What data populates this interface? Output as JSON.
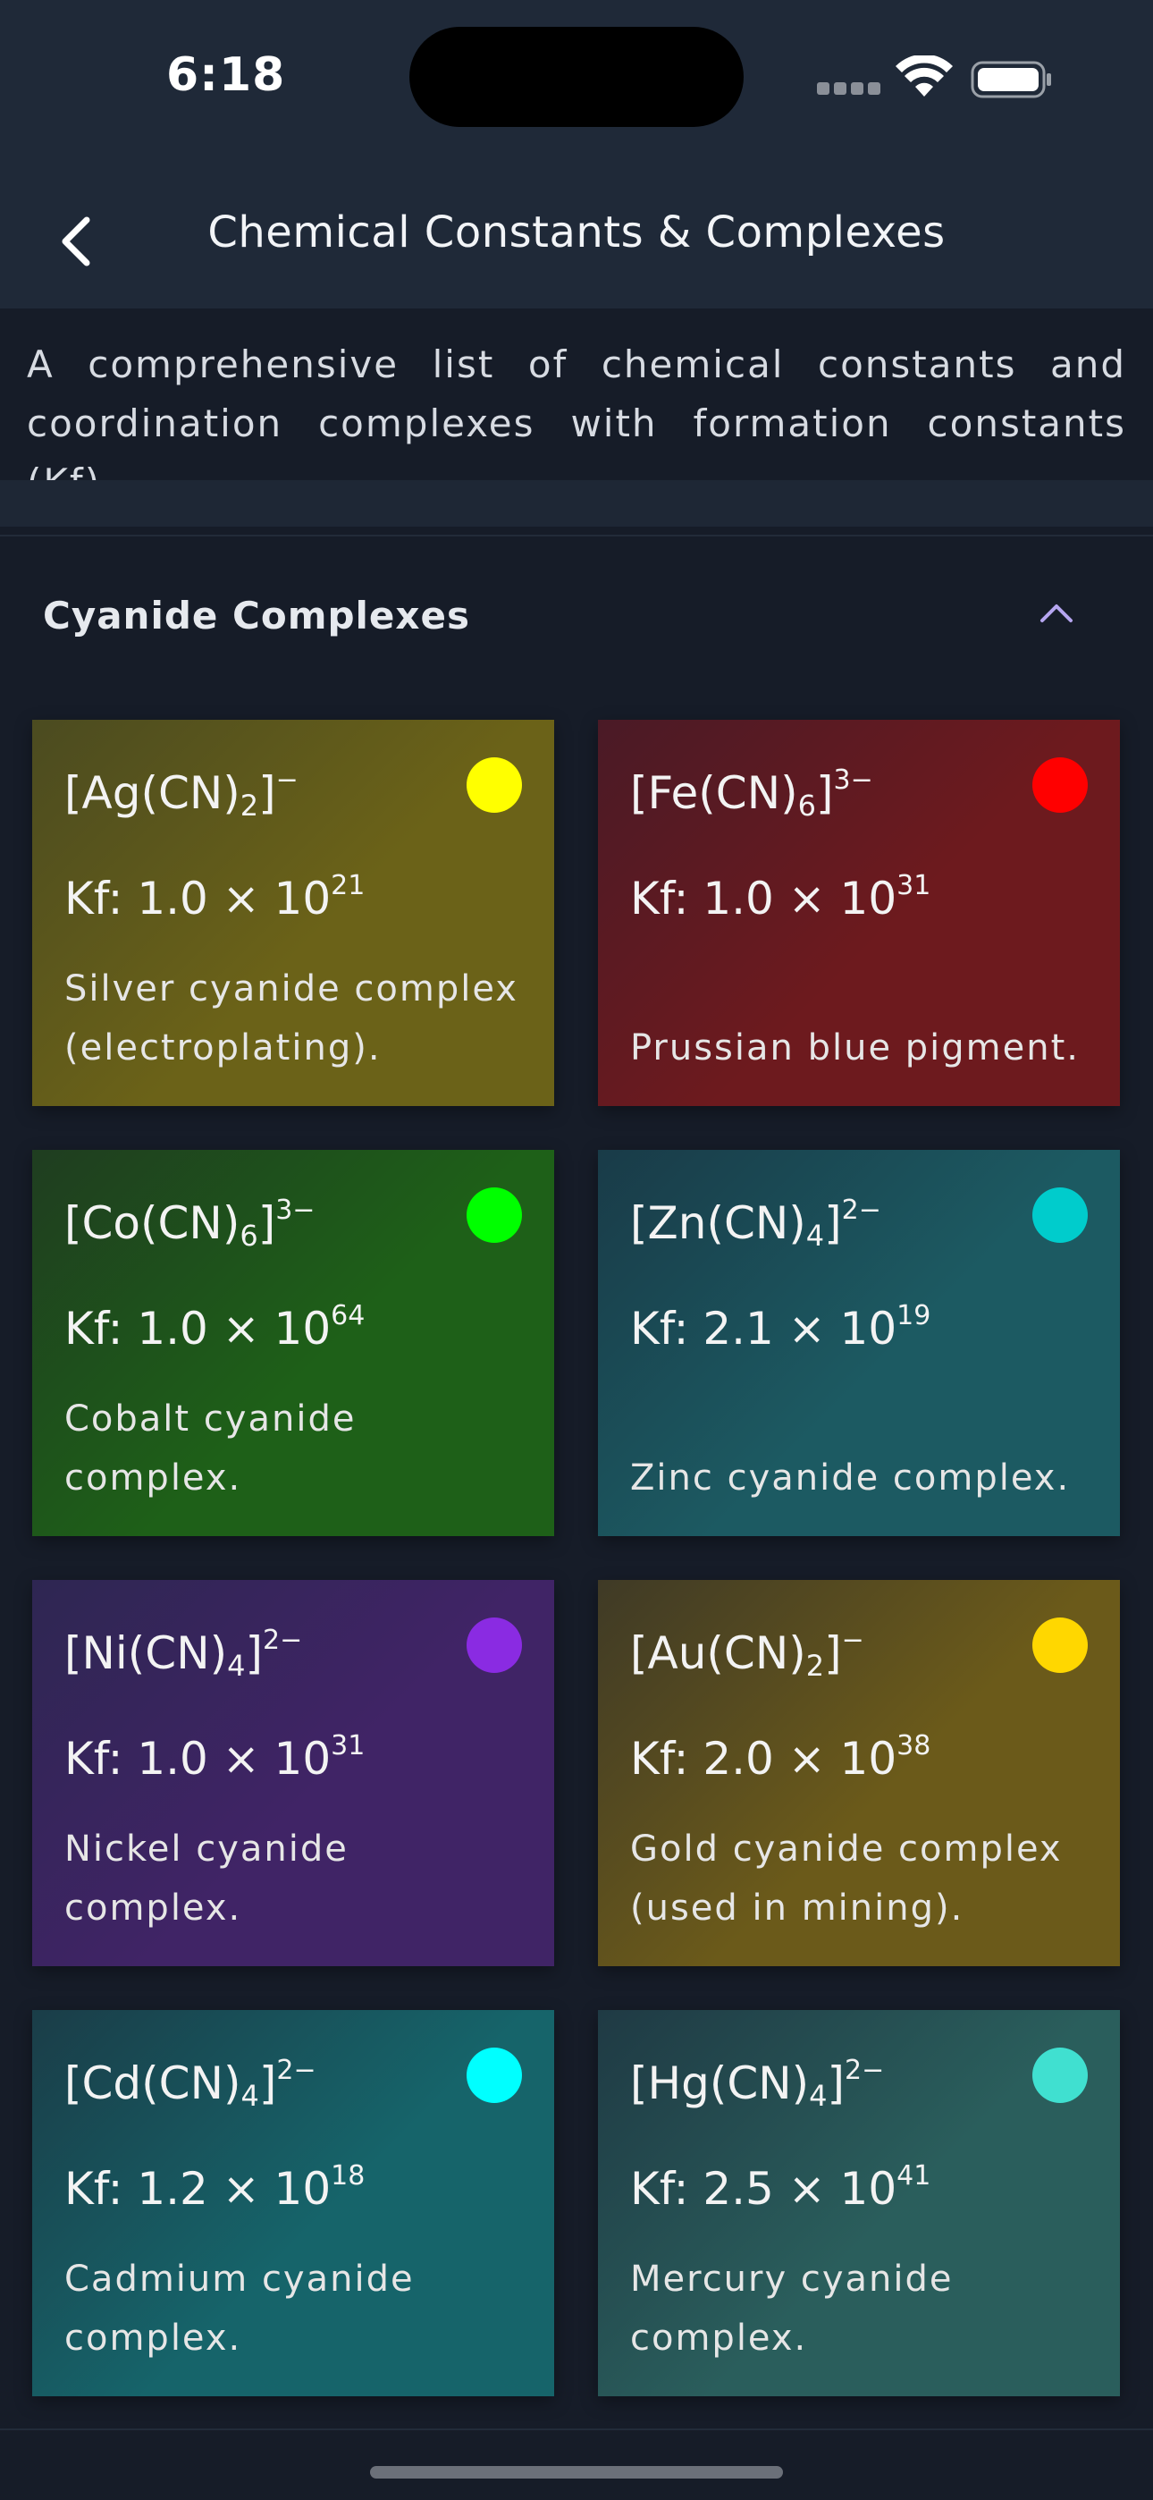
{
  "status": {
    "time": "6:18"
  },
  "header": {
    "title": "Chemical Constants & Complexes"
  },
  "description": "A comprehensive list of chemical constants and coordination complexes with formation constants (Kf).",
  "section": {
    "title": "Cyanide Complexes",
    "expanded": true
  },
  "cards": [
    {
      "metal": "Ag",
      "ligand_count": "2",
      "charge": "−",
      "kf_mantissa": "Kf: 1.0 × 10",
      "kf_exp": "21",
      "note": "Silver cyanide complex (electroplating).",
      "dot_color": "#ffff00",
      "bg": [
        "#4b4b20",
        "#6b6218"
      ]
    },
    {
      "metal": "Fe",
      "ligand_count": "6",
      "charge": "3−",
      "kf_mantissa": "Kf: 1.0 × 10",
      "kf_exp": "31",
      "note": "Prussian blue pigment.",
      "dot_color": "#ff0000",
      "bg": [
        "#4a1a26",
        "#6d1a1e"
      ]
    },
    {
      "metal": "Co",
      "ligand_count": "6",
      "charge": "3−",
      "kf_mantissa": "Kf: 1.0 × 10",
      "kf_exp": "64",
      "note": "Cobalt cyanide complex.",
      "dot_color": "#00ff00",
      "bg": [
        "#1f3d20",
        "#1e6018"
      ]
    },
    {
      "metal": "Zn",
      "ligand_count": "4",
      "charge": "2−",
      "kf_mantissa": "Kf: 2.1 × 10",
      "kf_exp": "19",
      "note": "Zinc cyanide complex.",
      "dot_color": "#00cccc",
      "bg": [
        "#193b48",
        "#1c5a62"
      ]
    },
    {
      "metal": "Ni",
      "ligand_count": "4",
      "charge": "2−",
      "kf_mantissa": "Kf: 1.0 × 10",
      "kf_exp": "31",
      "note": "Nickel cyanide complex.",
      "dot_color": "#8a2be2",
      "bg": [
        "#2e2652",
        "#402466"
      ]
    },
    {
      "metal": "Au",
      "ligand_count": "2",
      "charge": "−",
      "kf_mantissa": "Kf: 2.0 × 10",
      "kf_exp": "38",
      "note": "Gold cyanide complex (used in mining).",
      "dot_color": "#ffd700",
      "bg": [
        "#3f3a26",
        "#6b5a1a"
      ]
    },
    {
      "metal": "Cd",
      "ligand_count": "4",
      "charge": "2−",
      "kf_mantissa": "Kf: 1.2 × 10",
      "kf_exp": "18",
      "note": "Cadmium cyanide complex.",
      "dot_color": "#00ffff",
      "bg": [
        "#1a3d48",
        "#16646a"
      ]
    },
    {
      "metal": "Hg",
      "ligand_count": "4",
      "charge": "2−",
      "kf_mantissa": "Kf: 2.5 × 10",
      "kf_exp": "41",
      "note": "Mercury cyanide complex.",
      "dot_color": "#40e0d0",
      "bg": [
        "#1f3a44",
        "#2a5e5c"
      ]
    }
  ]
}
